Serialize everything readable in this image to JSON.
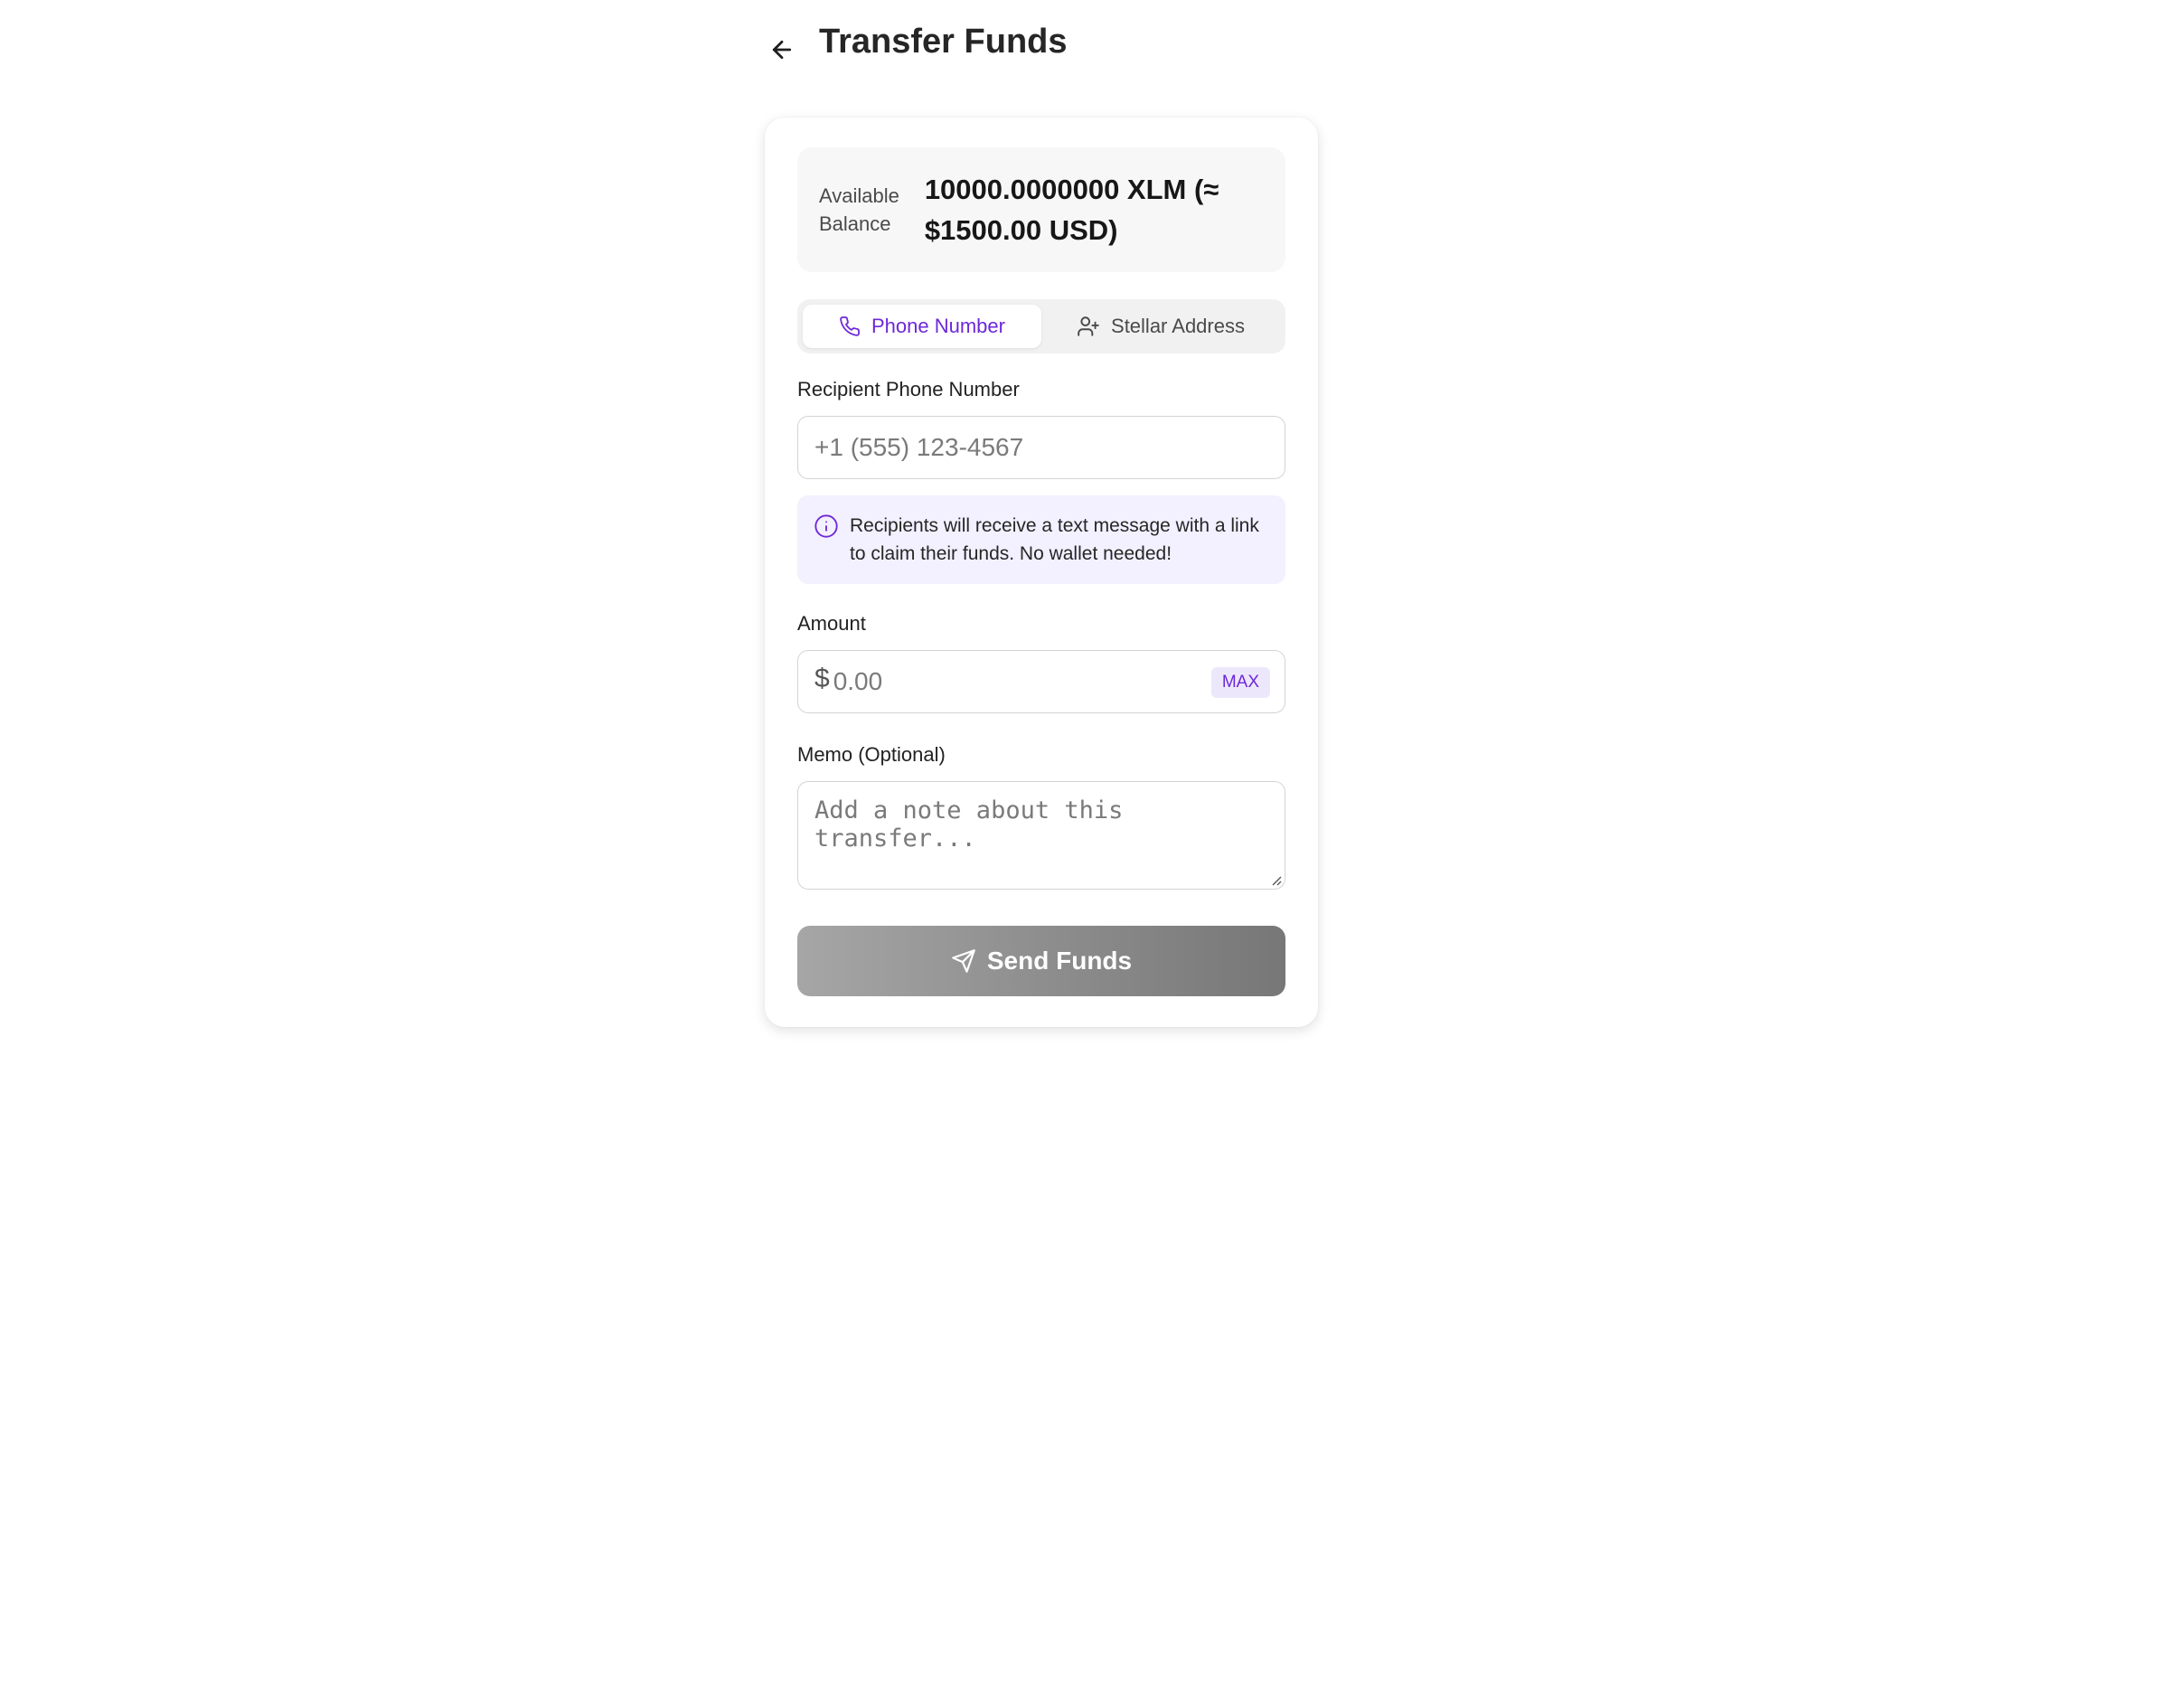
{
  "header": {
    "title": "Transfer Funds",
    "back_icon": "arrow-left-icon"
  },
  "balance": {
    "label": "Available Balance",
    "value": "10000.0000000 XLM (≈ $1500.00 USD)"
  },
  "tabs": [
    {
      "label": "Phone Number",
      "icon": "phone-icon",
      "active": true
    },
    {
      "label": "Stellar Address",
      "icon": "user-plus-icon",
      "active": false
    }
  ],
  "recipient": {
    "label": "Recipient Phone Number",
    "placeholder": "+1 (555) 123-4567"
  },
  "info": {
    "icon": "info-icon",
    "text": "Recipients will receive a text message with a link to claim their funds. No wallet needed!"
  },
  "amount": {
    "label": "Amount",
    "currency_symbol": "$",
    "placeholder": "0.00",
    "max_label": "MAX"
  },
  "memo": {
    "label": "Memo (Optional)",
    "placeholder": "Add a note about this transfer..."
  },
  "send": {
    "label": "Send Funds",
    "icon": "send-icon"
  },
  "colors": {
    "accent": "#6d28d9",
    "info_bg": "#f3f0ff",
    "button_gradient_start": "#a6a6a6",
    "button_gradient_end": "#777777"
  }
}
